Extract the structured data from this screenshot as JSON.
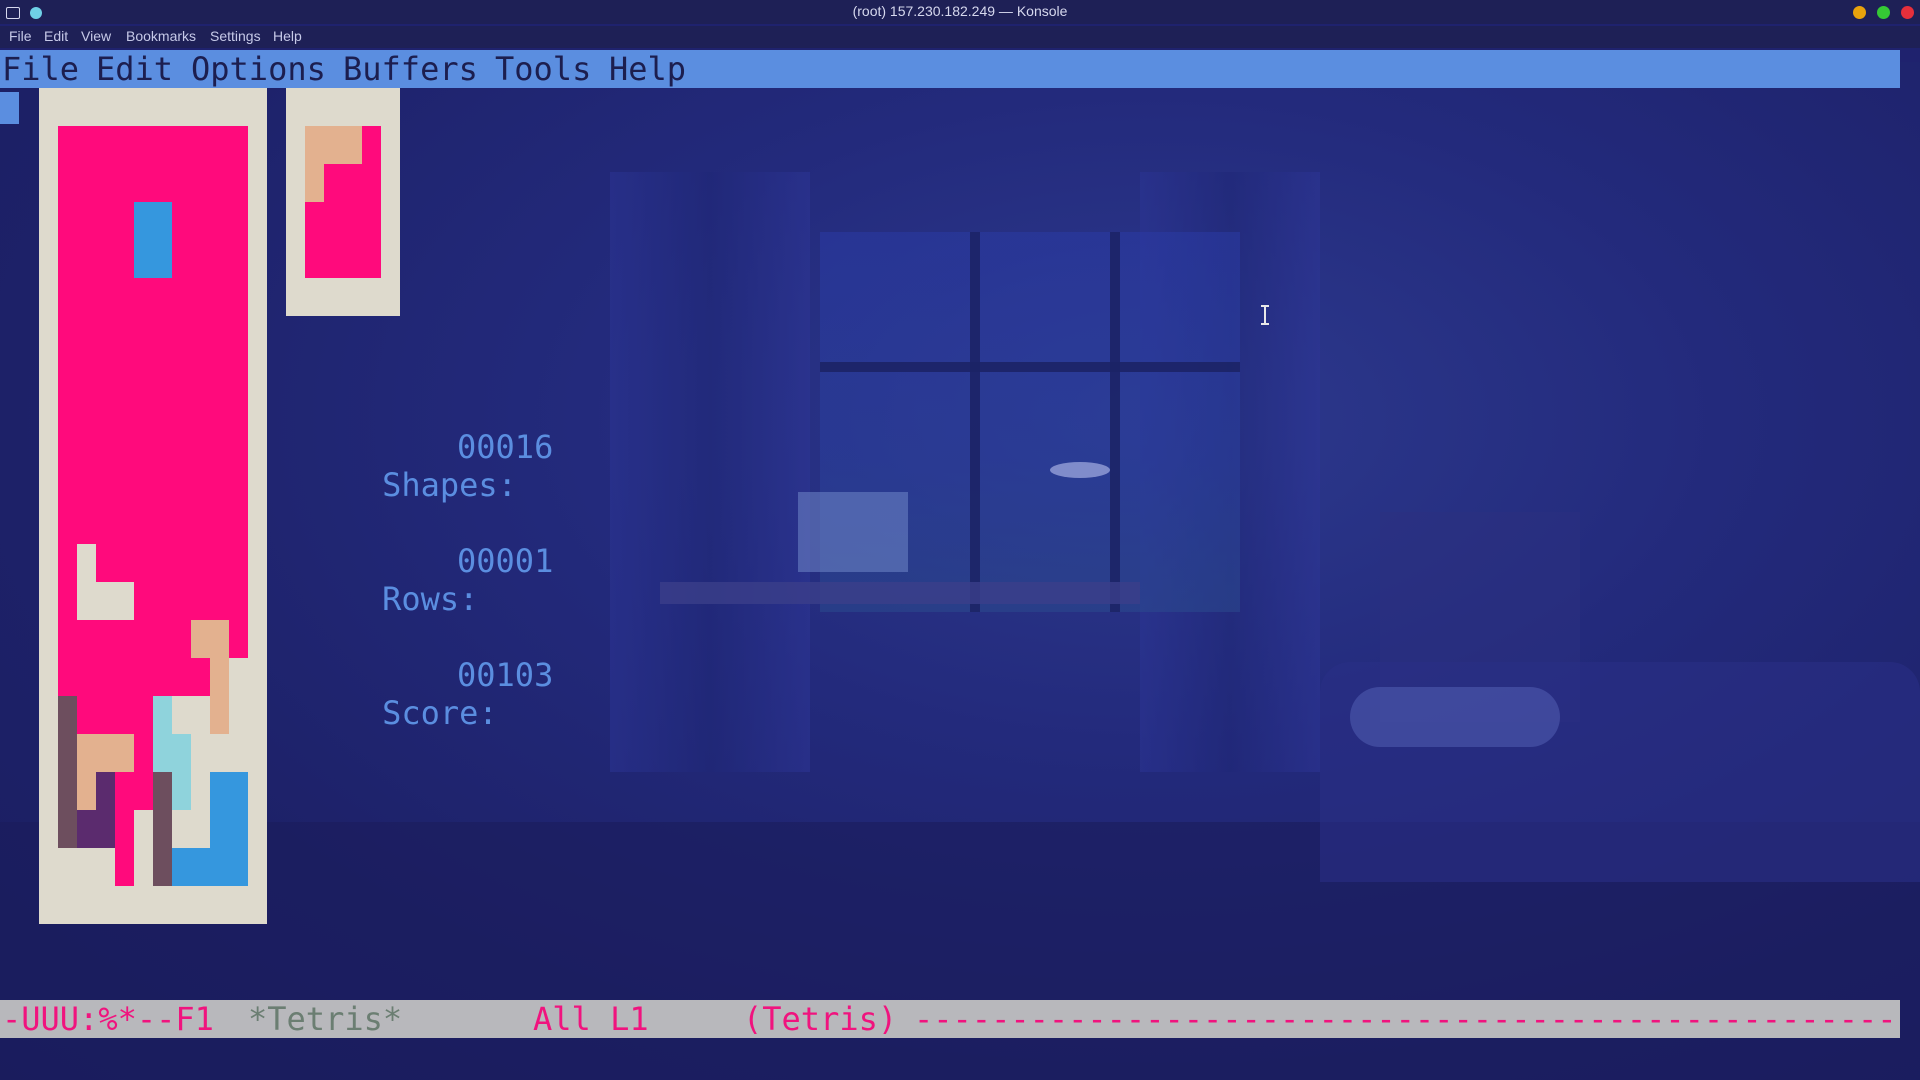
{
  "window": {
    "title": "(root) 157.230.182.249 — Konsole",
    "controls": {
      "minimize_color": "#e8a20c",
      "maximize_color": "#35c935",
      "close_color": "#e62f3b"
    }
  },
  "konsole_menu": [
    "File",
    "Edit",
    "View",
    "Bookmarks",
    "Settings",
    "Help"
  ],
  "emacs_menu": [
    "File",
    "Edit",
    "Options",
    "Buffers",
    "Tools",
    "Help"
  ],
  "game": {
    "name": "Tetris",
    "stats": [
      {
        "label": "Shapes:",
        "value": "00016"
      },
      {
        "label": "Rows:",
        "value": "00001"
      },
      {
        "label": "Score:",
        "value": "00103"
      }
    ]
  },
  "colors": {
    "pink": "#ff0a7c",
    "blue": "#3597de",
    "peach": "#e3b18f",
    "brown": "#6d4e5e",
    "purple": "#5b2b6e",
    "cyan": "#8fd3dc",
    "board_bg": "#dedacd",
    "accent": "#5b8ee0"
  },
  "modeline": {
    "status": "-UUU:%*--F1",
    "buffer": "*Tetris*",
    "position": "All L1",
    "mode": "(Tetris)",
    "dashes": "-----------------------------------------------------------------------------------------------------"
  }
}
